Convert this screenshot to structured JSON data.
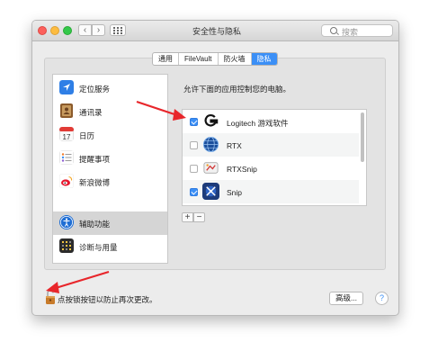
{
  "window": {
    "title": "安全性与隐私",
    "search_placeholder": "搜索"
  },
  "tabs": [
    {
      "label": "通用",
      "active": false
    },
    {
      "label": "FileVault",
      "active": false
    },
    {
      "label": "防火墙",
      "active": false
    },
    {
      "label": "隐私",
      "active": true
    }
  ],
  "sidebar": {
    "items": [
      {
        "label": "定位服务",
        "icon": "location-arrow-icon",
        "selected": false
      },
      {
        "label": "通讯录",
        "icon": "contacts-book-icon",
        "selected": false
      },
      {
        "label": "日历",
        "icon": "calendar-icon",
        "selected": false,
        "icon_text": "17"
      },
      {
        "label": "提醒事项",
        "icon": "reminders-icon",
        "selected": false
      },
      {
        "label": "新浪微博",
        "icon": "weibo-icon",
        "selected": false
      },
      {
        "label": "辅助功能",
        "icon": "accessibility-icon",
        "selected": true
      },
      {
        "label": "诊断与用量",
        "icon": "diagnostics-icon",
        "selected": false
      }
    ]
  },
  "main": {
    "description": "允许下面的应用控制您的电脑。",
    "apps": [
      {
        "name": "Logitech 游戏软件",
        "checked": true,
        "icon": "logitech-g-icon"
      },
      {
        "name": "RTX",
        "checked": false,
        "icon": "rtx-globe-icon"
      },
      {
        "name": "RTXSnip",
        "checked": false,
        "icon": "rtxsnip-icon"
      },
      {
        "name": "Snip",
        "checked": true,
        "icon": "snip-icon"
      }
    ],
    "add_label": "+",
    "remove_label": "−"
  },
  "footer": {
    "lock_text": "点按锁按钮以防止再次更改。",
    "advanced_label": "高级...",
    "help_label": "?"
  },
  "colors": {
    "accent": "#3b8ff6",
    "annotation_arrow": "#e8262b"
  }
}
